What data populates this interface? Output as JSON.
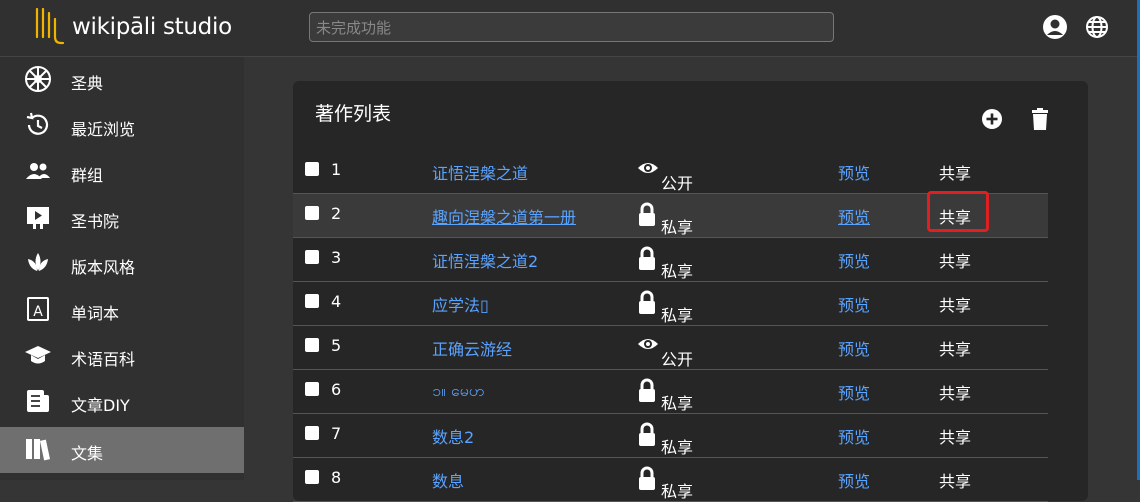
{
  "app": {
    "name": "wikipāli studio",
    "search_placeholder": "未完成功能"
  },
  "sidebar": {
    "items": [
      {
        "label": "圣典",
        "icon": "wheel-icon"
      },
      {
        "label": "最近浏览",
        "icon": "history-icon"
      },
      {
        "label": "群组",
        "icon": "group-icon"
      },
      {
        "label": "圣书院",
        "icon": "course-icon"
      },
      {
        "label": "版本风格",
        "icon": "lotus-icon"
      },
      {
        "label": "单词本",
        "icon": "dictionary-icon"
      },
      {
        "label": "术语百科",
        "icon": "graduation-cap-icon"
      },
      {
        "label": "文章DIY",
        "icon": "article-icon"
      },
      {
        "label": "文集",
        "icon": "books-icon",
        "active": true
      }
    ]
  },
  "card": {
    "title": "著作列表"
  },
  "rows": [
    {
      "num": "1",
      "title": "证悟涅槃之道",
      "privacy": "公开",
      "privacy_icon": "eye-icon",
      "preview": "预览",
      "share": "共享"
    },
    {
      "num": "2",
      "title": "趣向涅槃之道第一册",
      "privacy": "私享",
      "privacy_icon": "lock-icon",
      "preview": "预览",
      "share": "共享"
    },
    {
      "num": "3",
      "title": "证悟涅槃之道2",
      "privacy": "私享",
      "privacy_icon": "lock-icon",
      "preview": "预览",
      "share": "共享"
    },
    {
      "num": "4",
      "title": "应学法▯",
      "privacy": "私享",
      "privacy_icon": "lock-icon",
      "preview": "预览",
      "share": "共享"
    },
    {
      "num": "5",
      "title": "正确云游经",
      "privacy": "公开",
      "privacy_icon": "eye-icon",
      "preview": "预览",
      "share": "共享"
    },
    {
      "num": "6",
      "title": "၁။ မေဟ",
      "privacy": "私享",
      "privacy_icon": "lock-icon",
      "preview": "预览",
      "share": "共享"
    },
    {
      "num": "7",
      "title": "数息2",
      "privacy": "私享",
      "privacy_icon": "lock-icon",
      "preview": "预览",
      "share": "共享"
    },
    {
      "num": "8",
      "title": "数息",
      "privacy": "私享",
      "privacy_icon": "lock-icon",
      "preview": "预览",
      "share": "共享"
    }
  ],
  "colors": {
    "link": "#5aa3ff",
    "highlight": "#e02020"
  }
}
